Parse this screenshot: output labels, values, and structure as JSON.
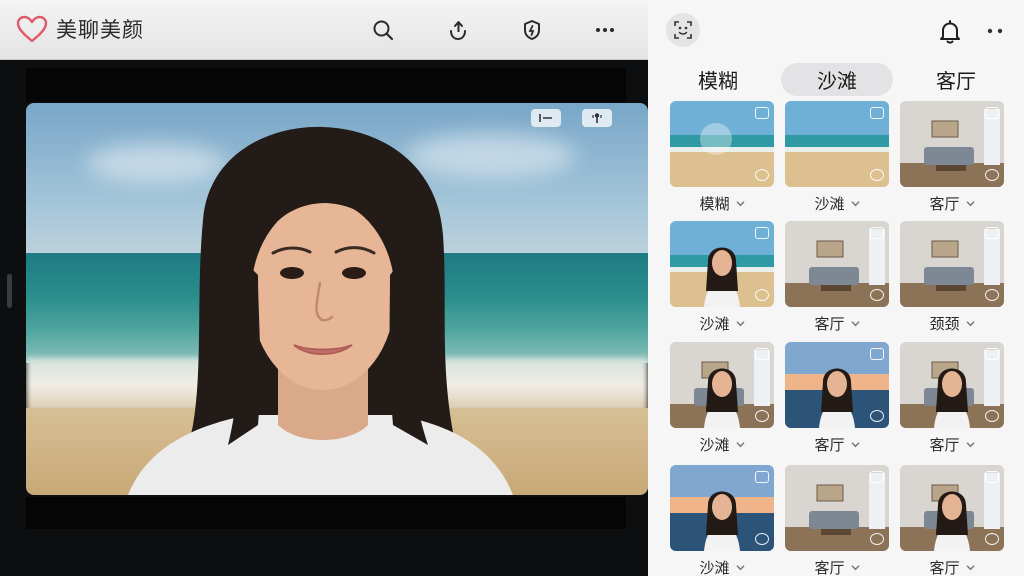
{
  "app": {
    "title": "美聊美颜"
  },
  "toolbar": {
    "icons": [
      "search-icon",
      "share-icon",
      "shield-icon",
      "more-icon"
    ]
  },
  "video": {
    "controls": [
      "aspect-icon",
      "mic-icon"
    ]
  },
  "panel": {
    "icons": [
      "face-scan-icon",
      "bell-icon",
      "more-icon"
    ],
    "tabs": [
      {
        "label": "模糊",
        "active": false
      },
      {
        "label": "沙滩",
        "active": true
      },
      {
        "label": "客厅",
        "active": false
      }
    ],
    "items": [
      {
        "label": "模糊",
        "scene": "beach-blur",
        "person": false
      },
      {
        "label": "沙滩",
        "scene": "beach",
        "person": false
      },
      {
        "label": "客厅",
        "scene": "living",
        "person": false
      },
      {
        "label": "沙滩",
        "scene": "beach",
        "person": true
      },
      {
        "label": "客厅",
        "scene": "living",
        "person": false
      },
      {
        "label": "颈颈",
        "scene": "living",
        "person": false
      },
      {
        "label": "沙滩",
        "scene": "living",
        "person": true
      },
      {
        "label": "客厅",
        "scene": "sunset",
        "person": true
      },
      {
        "label": "客厅",
        "scene": "living",
        "person": true
      },
      {
        "label": "沙滩",
        "scene": "sunset",
        "person": true
      },
      {
        "label": "客厅",
        "scene": "living",
        "person": false
      },
      {
        "label": "客厅",
        "scene": "living",
        "person": true
      }
    ]
  },
  "colors": {
    "accent": "#e05a6b",
    "panel_bg": "#f6f6f6",
    "tab_active": "#e3e3e5"
  }
}
